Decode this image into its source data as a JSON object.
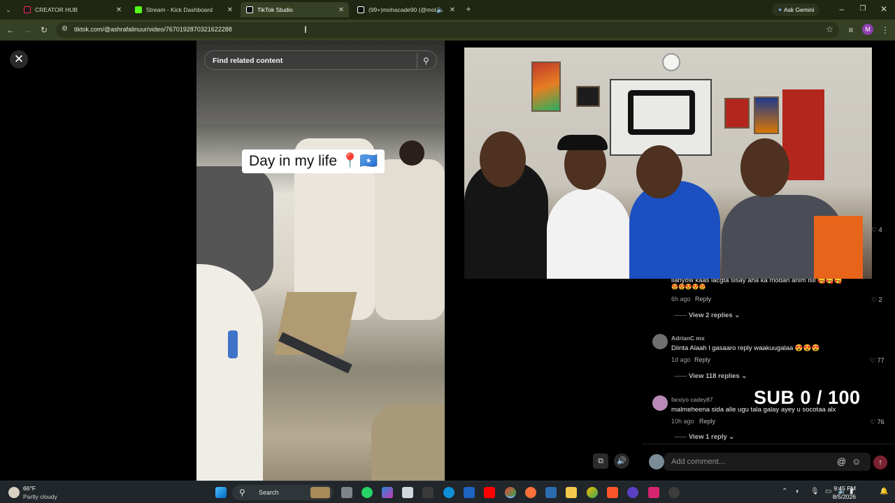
{
  "browser": {
    "tabs": [
      {
        "title": "CREATOR HUB",
        "icon": "creator-hub-icon",
        "color": "#ff2c55"
      },
      {
        "title": "Stream - Kick Dashboard",
        "icon": "kick-icon",
        "color": "#53fc18"
      },
      {
        "title": "TikTok Studio",
        "icon": "tiktok-icon",
        "color": "#ffffff"
      },
      {
        "title": "(99+)mohacade90 (@moha",
        "icon": "tiktok-icon",
        "color": "#ffffff"
      }
    ],
    "url": "tiktok.com/@ashrafalinuur/video/7670192870321622288",
    "gemini_label": "Ask Gemini",
    "profile_initial": "M"
  },
  "video": {
    "search_placeholder": "Find related content",
    "caption": "Day in my life 📍🇸🇴"
  },
  "stream": {
    "sub_counter": "SUB 0 / 100"
  },
  "comments": {
    "partial_text": "ilahyow kaas lacgta sisay aha ka modan anim isii 🥰🥰🥰",
    "partial_emojis": "😍😍😍😍😍",
    "partial_meta": "6h ago",
    "items": [
      {
        "name": "",
        "text": "",
        "meta": "",
        "likes": "4",
        "replies": ""
      },
      {
        "name": "",
        "text": "",
        "meta": "6h ago",
        "likes": "2",
        "replies": "View 2 replies"
      },
      {
        "name": "AdrianC mx",
        "text": "Diinta Alaah l gasaaro reply waakuugalaa 😍😍😍",
        "meta": "1d ago",
        "likes": "77",
        "replies": "View 118 replies"
      },
      {
        "name": "farxiyo cadey87",
        "text": "malmeheena sida alle ugu tala galay ayey u socotaa alx",
        "meta": "10h ago",
        "likes": "76",
        "replies": "View 1 reply"
      }
    ],
    "reply_label": "Reply",
    "add_placeholder": "Add comment..."
  },
  "taskbar": {
    "weather_temp": "66°F",
    "weather_desc": "Partly cloudy",
    "search_label": "Search",
    "time": "9:45 PM",
    "date": "8/5/2026"
  }
}
